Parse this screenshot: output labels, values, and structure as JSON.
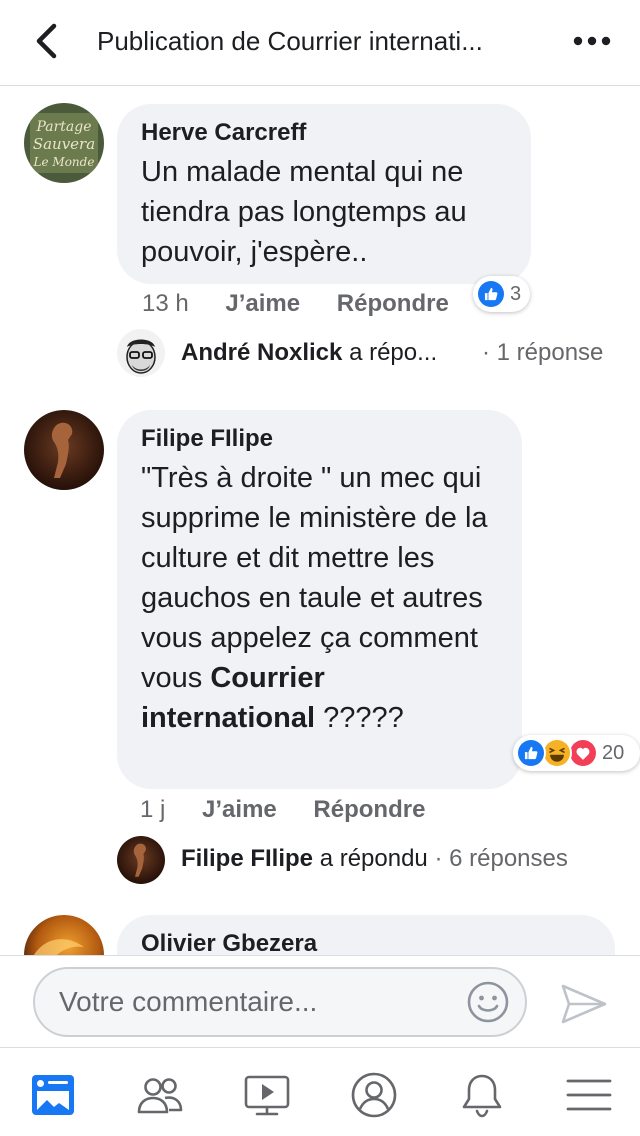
{
  "header": {
    "title": "Publication de Courrier internati..."
  },
  "comments": [
    {
      "author": "Herve Carcreff",
      "text": "Un malade mental qui ne tiendra pas longtemps au pouvoir, j'espère..",
      "time": "13 h",
      "like_label": "J’aime",
      "reply_label": "Répondre",
      "reaction_count": "3",
      "avatar_lines": [
        "Partage",
        "Sauvera",
        "Le Monde"
      ],
      "reply": {
        "name": "André Noxlick",
        "action": "a répo...",
        "count": "· 1 réponse"
      }
    },
    {
      "author": "Filipe FIlipe",
      "text_before": "\"Très à droite \" un mec qui supprime le ministère de la culture et dit mettre les gauchos en taule et autres vous appelez ça comment vous",
      "text_bold": "Courrier international",
      "text_after": " ?????",
      "time": "1 j",
      "like_label": "J’aime",
      "reply_label": "Répondre",
      "reaction_count": "20",
      "reply": {
        "name": "Filipe FIlipe",
        "action": "a répondu",
        "count": "· 6 réponses"
      }
    },
    {
      "author": "Olivier Gbezera"
    }
  ],
  "composer": {
    "placeholder": "Votre commentaire..."
  },
  "colors": {
    "like_blue": "#1877f2",
    "love_red": "#f33e58",
    "haha_yellow": "#f7b125",
    "nav_blue": "#1877f2",
    "icon_gray": "#65676b"
  }
}
